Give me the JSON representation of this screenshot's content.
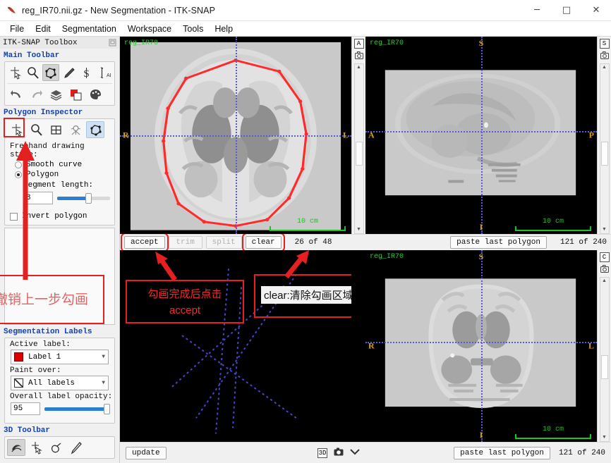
{
  "window": {
    "title": "reg_IR70.nii.gz - New Segmentation - ITK-SNAP",
    "minimize": "─",
    "maximize": "□",
    "close": "✕"
  },
  "menu": {
    "items": [
      "File",
      "Edit",
      "Segmentation",
      "Workspace",
      "Tools",
      "Help"
    ]
  },
  "toolbox": {
    "header": "ITK-SNAP Toolbox",
    "main_toolbar": {
      "title": "Main Toolbar",
      "row1": [
        {
          "name": "crosshair-tool-icon",
          "selected": false
        },
        {
          "name": "zoom-pan-tool-icon",
          "selected": false
        },
        {
          "name": "polygon-tool-icon",
          "selected": true
        },
        {
          "name": "paintbrush-tool-icon",
          "selected": false
        },
        {
          "name": "snake-tool-icon",
          "selected": false
        },
        {
          "name": "annotation-tool-icon",
          "selected": false
        }
      ],
      "row2": [
        {
          "name": "undo-icon",
          "selected": false
        },
        {
          "name": "redo-icon",
          "selected": false
        },
        {
          "name": "layers-icon",
          "selected": false
        },
        {
          "name": "label-color-icon",
          "selected": false
        },
        {
          "name": "palette-icon",
          "selected": false
        }
      ]
    },
    "polygon_inspector": {
      "title": "Polygon Inspector",
      "icons": [
        {
          "name": "crosshair-tool-icon",
          "selected": false
        },
        {
          "name": "zoom-pan-tool-icon",
          "selected": false
        },
        {
          "name": "grid-tool-icon",
          "selected": false
        },
        {
          "name": "contrast-tool-icon",
          "selected": false
        },
        {
          "name": "polygon-tool-icon",
          "selected": true
        }
      ],
      "style_label": "Freehand drawing style:",
      "option_smooth": "Smooth curve",
      "option_polygon": "Polygon",
      "selected_style": "Polygon",
      "segment_length_label": "Segment length:",
      "segment_length_value": "8",
      "segment_length_percent": 58,
      "invert_label": "Invert polygon",
      "invert_checked": false
    },
    "segmentation_labels": {
      "title": "Segmentation Labels",
      "active_label_caption": "Active label:",
      "active_label_value": "Label 1",
      "active_label_color": "#e00000",
      "paint_over_caption": "Paint over:",
      "paint_over_value": "All labels",
      "opacity_caption": "Overall label opacity:",
      "opacity_value": "95",
      "opacity_percent": 95
    },
    "toolbar_3d": {
      "title": "3D Toolbar",
      "icons": [
        {
          "name": "trackball-3d-icon",
          "selected": true
        },
        {
          "name": "crosshair-3d-icon",
          "selected": false
        },
        {
          "name": "spray-3d-icon",
          "selected": false
        },
        {
          "name": "scalpel-3d-icon",
          "selected": false
        }
      ]
    }
  },
  "annotations": {
    "undo_note": "撤销上一步勾画",
    "accept_note_line1": "勾画完成后点击",
    "accept_note_line2": "accept",
    "clear_note": "clear:清除勾画区域",
    "highlight_color": "#e52020"
  },
  "viewports": {
    "axial": {
      "badge": "A",
      "image_label": "reg_IR70",
      "orient_top": "",
      "orient_bottom": "",
      "orient_left": "R",
      "orient_right": "L",
      "scale_text": "10 cm"
    },
    "sagittal": {
      "badge": "S",
      "image_label": "reg_IR70",
      "orient_top": "S",
      "orient_bottom": "I",
      "orient_left": "A",
      "orient_right": "P",
      "scale_text": "10 cm"
    },
    "three_d": {
      "badge": "",
      "image_label": "",
      "scale_text": ""
    },
    "coronal": {
      "badge": "C",
      "image_label": "reg_IR70",
      "orient_top": "S",
      "orient_bottom": "I",
      "orient_left": "R",
      "orient_right": "L",
      "scale_text": "10 cm"
    }
  },
  "polygon_toolbar": {
    "accept": "accept",
    "trim": "trim",
    "split": "split",
    "clear": "clear",
    "slice_counter": "26 of 48"
  },
  "sagittal_toolbar": {
    "paste_last_polygon": "paste last polygon",
    "slice_counter": "121 of 240"
  },
  "coronal_toolbar": {
    "paste_last_polygon": "paste last polygon",
    "slice_counter": "121 of 240"
  },
  "bottom_bar": {
    "update": "update",
    "icon_3d": "3D",
    "camera_icon": "camera-icon",
    "chevron_icon": "chevron-down-icon"
  }
}
